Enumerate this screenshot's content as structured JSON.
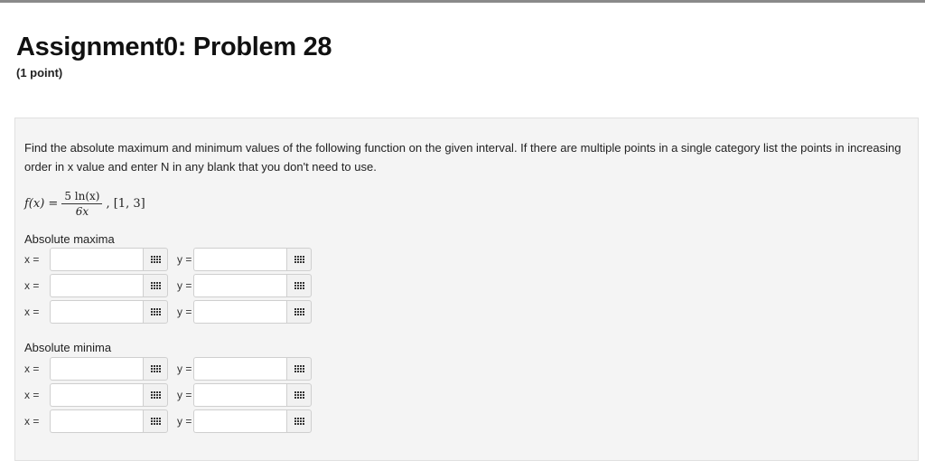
{
  "header": {
    "title": "Assignment0: Problem 28",
    "points": "(1 point)"
  },
  "problem": {
    "instructions": "Find the absolute maximum and minimum values of the following function on the given interval. If there are multiple points in a single category list the points in increasing order in x value and enter N in any blank that you don't need to use.",
    "function_lhs": "f(x) =",
    "numerator": "5 ln(x)",
    "denominator": "6x",
    "interval": ", [1, 3]"
  },
  "maxima": {
    "label": "Absolute maxima",
    "rows": [
      {
        "x_label": "x =",
        "x_value": "",
        "y_label": "y =",
        "y_value": ""
      },
      {
        "x_label": "x =",
        "x_value": "",
        "y_label": "y =",
        "y_value": ""
      },
      {
        "x_label": "x =",
        "x_value": "",
        "y_label": "y =",
        "y_value": ""
      }
    ]
  },
  "minima": {
    "label": "Absolute minima",
    "rows": [
      {
        "x_label": "x =",
        "x_value": "",
        "y_label": "y =",
        "y_value": ""
      },
      {
        "x_label": "x =",
        "x_value": "",
        "y_label": "y =",
        "y_value": ""
      },
      {
        "x_label": "x =",
        "x_value": "",
        "y_label": "y =",
        "y_value": ""
      }
    ]
  },
  "icons": {
    "picker": "equation-editor-grid-icon"
  }
}
